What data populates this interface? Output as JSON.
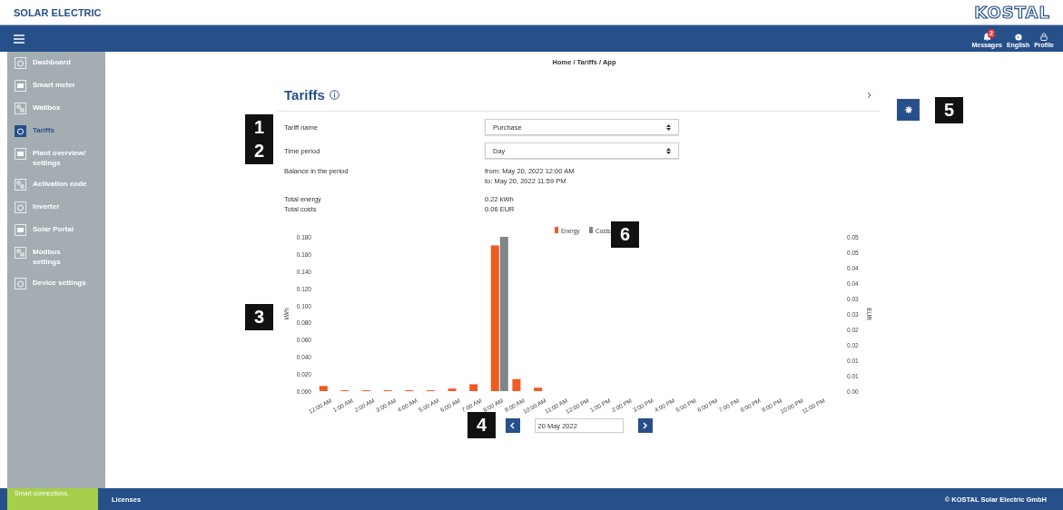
{
  "header": {
    "product": "SOLAR ELECTRIC",
    "logo": "KOSTAL"
  },
  "topbar": {
    "actions": [
      {
        "label": "Messages",
        "badge": "2"
      },
      {
        "label": "English"
      },
      {
        "label": "Profile"
      }
    ]
  },
  "sidebar": {
    "items": [
      {
        "label": "Dashboard",
        "selected": false
      },
      {
        "label": "Smart meter",
        "selected": false
      },
      {
        "label": "Wallbox",
        "selected": false
      },
      {
        "label": "Tariffs",
        "selected": true
      },
      {
        "label": "Plant overview/ settings",
        "selected": false
      },
      {
        "label": "Activation code",
        "selected": false
      },
      {
        "label": "Inverter",
        "selected": false
      },
      {
        "label": "Solar Portal",
        "selected": false
      },
      {
        "label": "Modbus settings",
        "selected": false
      },
      {
        "label": "Device settings",
        "selected": false
      }
    ],
    "footer": "Smart connections."
  },
  "breadcrumb": "Home / Tariffs / App",
  "page": {
    "title": "Tariffs",
    "settings_callout": "5"
  },
  "form": {
    "fields": [
      {
        "label": "Tariff name",
        "value": "Purchase",
        "callout": "1"
      },
      {
        "label": "Time period",
        "value": "Day",
        "callout": "2"
      }
    ]
  },
  "summary": [
    {
      "label": "Balance in the period",
      "lines": [
        "from: May 20, 2022 12:00 AM",
        "to: May 20, 2022 11:59 PM"
      ]
    },
    {
      "label": "Total energy",
      "lines": [
        "0.22 kWh"
      ]
    },
    {
      "label": "Total costs",
      "lines": [
        "0.06 EUR"
      ]
    }
  ],
  "chart": {
    "callout": "3",
    "legend_callout": "6",
    "chart_data": {
      "type": "bar",
      "ylabel": "kWh",
      "legend": "top",
      "y2label": "EUR",
      "y2lim": [
        0,
        0.05
      ],
      "y2ticks": [
        {
          "value": 0,
          "label": "0.00"
        },
        {
          "value": 0.005,
          "label": "0.01"
        },
        {
          "value": 0.01,
          "label": "0.01"
        },
        {
          "value": 0.015,
          "label": "0.02"
        },
        {
          "value": 0.02,
          "label": "0.02"
        },
        {
          "value": 0.025,
          "label": "0.03"
        },
        {
          "value": 0.03,
          "label": "0.03"
        },
        {
          "value": 0.035,
          "label": "0.04"
        },
        {
          "value": 0.04,
          "label": "0.04"
        },
        {
          "value": 0.045,
          "label": "0.05"
        },
        {
          "value": 0.05,
          "label": "0.05"
        }
      ],
      "categories": [
        "12:00 AM",
        "1:00 AM",
        "2:00 AM",
        "3:00 AM",
        "4:00 AM",
        "5:00 AM",
        "6:00 AM",
        "7:00 AM",
        "8:00 AM",
        "9:00 AM",
        "10:00 AM",
        "11:00 AM",
        "12:00 PM",
        "1:00 PM",
        "2:00 PM",
        "3:00 PM",
        "4:00 PM",
        "5:00 PM",
        "6:00 PM",
        "7:00 PM",
        "8:00 PM",
        "9:00 PM",
        "10:00 PM",
        "11:00 PM"
      ],
      "series": [
        {
          "name": "Energy",
          "color": "#f15a22",
          "values": [
            0.006,
            0.001,
            0.001,
            0.001,
            0.001,
            0.001,
            0.003,
            0.008,
            0.17,
            0.014,
            0.004,
            0,
            0,
            0,
            0,
            0,
            0,
            0,
            0,
            0,
            0,
            0,
            0,
            0
          ]
        },
        {
          "name": "Costs",
          "color": "#7e858b",
          "axis": "y2",
          "values": [
            0,
            0,
            0,
            0,
            0,
            0,
            0,
            0,
            0.05,
            0,
            0,
            0,
            0,
            0,
            0,
            0,
            0,
            0,
            0,
            0,
            0,
            0,
            0,
            0
          ]
        }
      ],
      "ylim": [
        0,
        0.18
      ],
      "yticks": [
        {
          "value": 0,
          "label": "0.000"
        },
        {
          "value": 0.02,
          "label": "0.020"
        },
        {
          "value": 0.04,
          "label": "0.040"
        },
        {
          "value": 0.06,
          "label": "0.060"
        },
        {
          "value": 0.08,
          "label": "0.080"
        },
        {
          "value": 0.1,
          "label": "0.100"
        },
        {
          "value": 0.12,
          "label": "0.120"
        },
        {
          "value": 0.14,
          "label": "0.140"
        },
        {
          "value": 0.16,
          "label": "0.160"
        },
        {
          "value": 0.18,
          "label": "0.180"
        }
      ]
    }
  },
  "date_nav": {
    "date": "20 May 2022",
    "callout": "4"
  },
  "footer": {
    "link": "Licenses",
    "copyright": "© KOSTAL Solar Electric GmbH"
  }
}
